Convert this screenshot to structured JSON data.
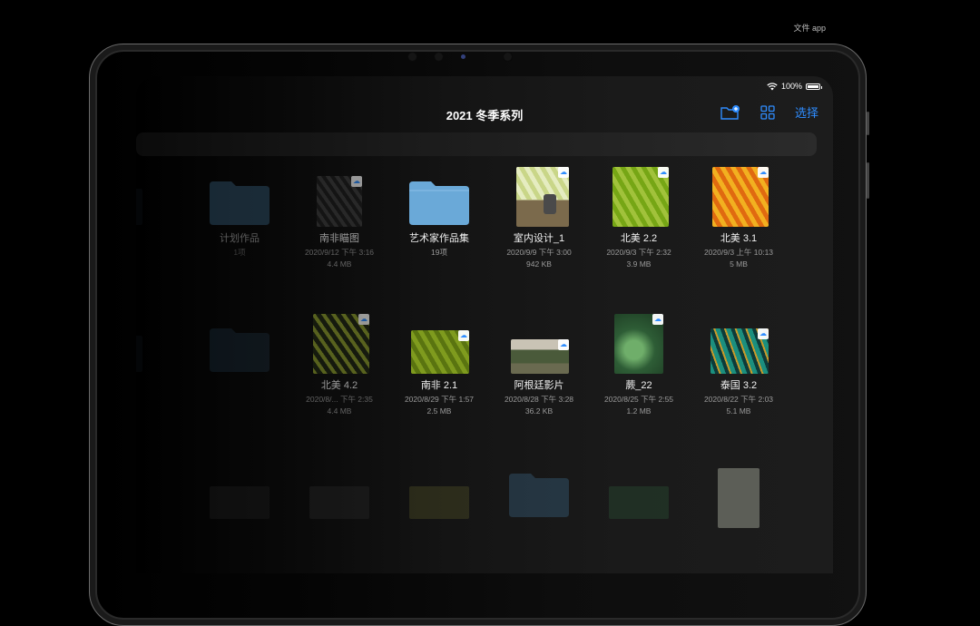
{
  "caption": "文件 app",
  "status": {
    "battery": "100%",
    "battery_level": 1.0
  },
  "header": {
    "title": "2021 冬季系列",
    "select_label": "选择"
  },
  "row1": [
    {
      "name": "计划作品",
      "meta1": "1项",
      "meta2": ""
    },
    {
      "name": "南非瞄图",
      "meta1": "2020/9/12 下午 3:16",
      "meta2": "4.4 MB"
    },
    {
      "name": "艺术家作品集",
      "meta1": "19项",
      "meta2": ""
    },
    {
      "name": "室内设计_1",
      "meta1": "2020/9/9 下午 3:00",
      "meta2": "942 KB"
    },
    {
      "name": "北美 2.2",
      "meta1": "2020/9/3 下午 2:32",
      "meta2": "3.9 MB"
    },
    {
      "name": "北美 3.1",
      "meta1": "2020/9/3 上午 10:13",
      "meta2": "5 MB"
    }
  ],
  "row2": [
    {
      "name": "北美 4.2",
      "meta1": "2020/8/... 下午 2:35",
      "meta2": "4.4 MB"
    },
    {
      "name": "南非 2.1",
      "meta1": "2020/8/29 下午 1:57",
      "meta2": "2.5 MB"
    },
    {
      "name": "阿根廷影片",
      "meta1": "2020/8/28 下午 3:28",
      "meta2": "36.2 KB"
    },
    {
      "name": "蕨_22",
      "meta1": "2020/8/25 下午 2:55",
      "meta2": "1.2 MB"
    },
    {
      "name": "泰国 3.2",
      "meta1": "2020/8/22 下午 2:03",
      "meta2": "5.1 MB"
    }
  ],
  "colors": {
    "accent": "#2f8dff",
    "folder": "#6aa9d8"
  }
}
